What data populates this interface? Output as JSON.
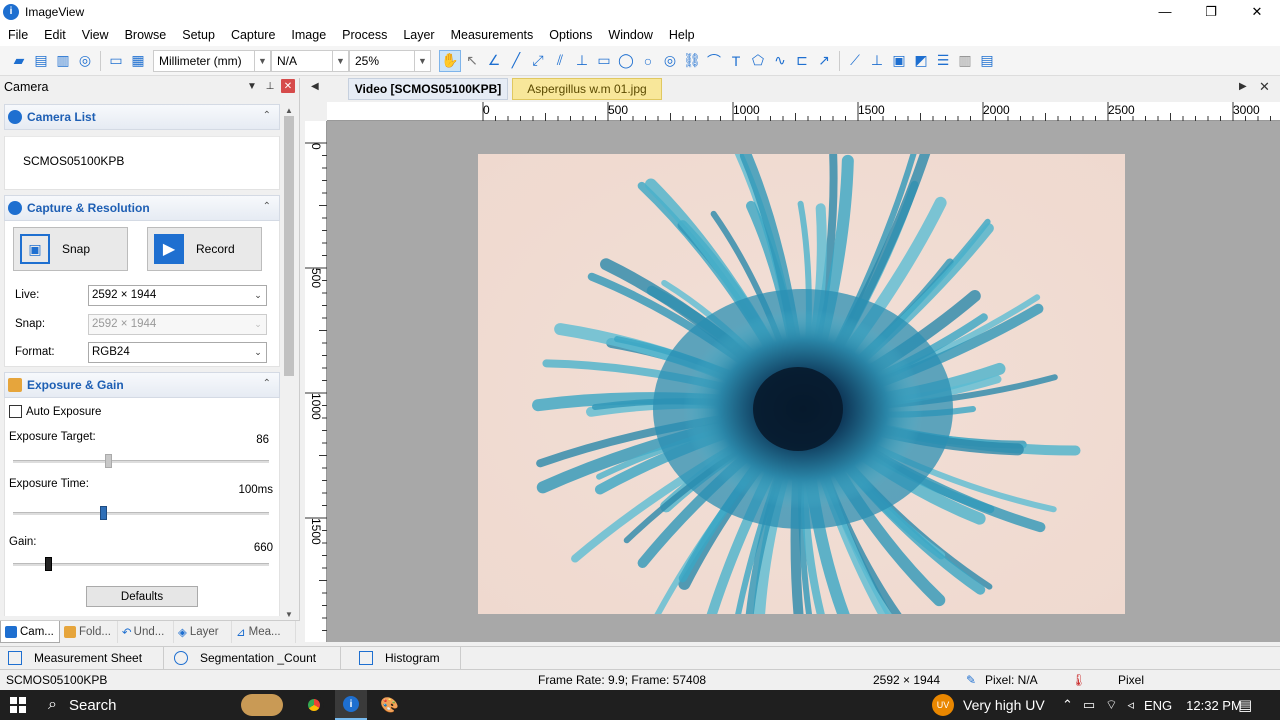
{
  "window": {
    "title": "ImageView",
    "controls": [
      "—",
      "❐",
      "✕"
    ]
  },
  "menu": [
    "File",
    "Edit",
    "View",
    "Browse",
    "Setup",
    "Capture",
    "Image",
    "Process",
    "Layer",
    "Measurements",
    "Options",
    "Window",
    "Help"
  ],
  "toolbar": {
    "unit": "Millimeter (mm)",
    "magnification": "N/A",
    "zoom": "25%"
  },
  "camera_panel": {
    "title": "Camera",
    "camera_list": {
      "title": "Camera List",
      "items": [
        "SCMOS05100KPB"
      ]
    },
    "capture": {
      "title": "Capture & Resolution",
      "snap_label": "Snap",
      "record_label": "Record",
      "live_label": "Live:",
      "live_value": "2592 × 1944",
      "snap_res_label": "Snap:",
      "snap_res_value": "2592 × 1944",
      "format_label": "Format:",
      "format_value": "RGB24"
    },
    "exposure": {
      "title": "Exposure & Gain",
      "auto_label": "Auto Exposure",
      "auto_checked": false,
      "target_label": "Exposure Target:",
      "target_value": "86",
      "target_fraction": 0.37,
      "time_label": "Exposure Time:",
      "time_value": "100ms",
      "time_fraction": 0.35,
      "gain_label": "Gain:",
      "gain_value": "660",
      "gain_fraction": 0.13,
      "defaults_label": "Defaults"
    }
  },
  "dock_tabs": [
    "Cam...",
    "Fold...",
    "Und...",
    "Layer",
    "Mea..."
  ],
  "doc_tabs": {
    "video": "Video [SCMOS05100KPB]",
    "image": "Aspergillus w.m 01.jpg"
  },
  "hruler": [
    "0",
    "500",
    "1000",
    "1500",
    "2000",
    "2500",
    "3000"
  ],
  "vruler": [
    "0",
    "500",
    "1000",
    "1500"
  ],
  "bottom_tabs": [
    "Measurement Sheet",
    "Segmentation _Count",
    "Histogram"
  ],
  "status": {
    "camera": "SCMOS05100KPB",
    "frame": "Frame Rate: 9.9; Frame: 57408",
    "resolution": "2592 × 1944",
    "pixel": "Pixel: N/A",
    "unit": "Pixel"
  },
  "taskbar": {
    "search": "Search",
    "weather_badge": "UV",
    "weather": "Very high UV",
    "lang": "ENG",
    "time": "12:32 PM"
  },
  "colors": {
    "accent": "#1e6fd0",
    "section_title": "#1e5fb4",
    "image_tab": "#f8e79a"
  }
}
